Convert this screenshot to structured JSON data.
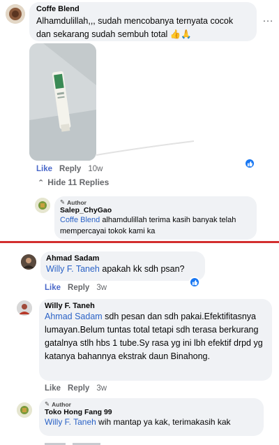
{
  "post1": {
    "name": "Coffe Blend",
    "text": "Alhamdulillah,,, sudah mencobanya ternyata cocok dan sekarang sudah sembuh total 👍🙏",
    "more": "…",
    "actions": {
      "like": "Like",
      "reply": "Reply",
      "time": "10w"
    }
  },
  "hide_replies": "Hide 11 Replies",
  "reply1": {
    "author_tag": "Author",
    "name": "Salep_ChyGao",
    "mention": "Coffe Blend",
    "text": " alhamdulillah terima kasih banyak telah mempercayai tokok kami ka"
  },
  "comment2": {
    "name": "Ahmad Sadam",
    "mention": "Willy F. Taneh",
    "text": " apakah kk sdh psan?",
    "actions": {
      "like": "Like",
      "reply": "Reply",
      "time": "3w"
    }
  },
  "comment3": {
    "name": "Willy F. Taneh",
    "mention": "Ahmad Sadam",
    "text": " sdh pesan dan sdh pakai.Efektifitasnya lumayan.Belum tuntas total tetapi sdh terasa berkurang gatalnya stlh hbs 1 tube.Sy rasa yg ini lbh efektif drpd yg katanya bahannya ekstrak daun Binahong.",
    "actions": {
      "like": "Like",
      "reply": "Reply",
      "time": "3w"
    }
  },
  "reply4": {
    "author_tag": "Author",
    "name": "Toko Hong Fang 99",
    "mention": "Willy F. Taneh",
    "text": " wih mantap ya kak, terimakasih kak"
  },
  "colors": {
    "accent": "#1877f2",
    "divider": "#d32f2f",
    "bubble": "#f0f2f5"
  }
}
